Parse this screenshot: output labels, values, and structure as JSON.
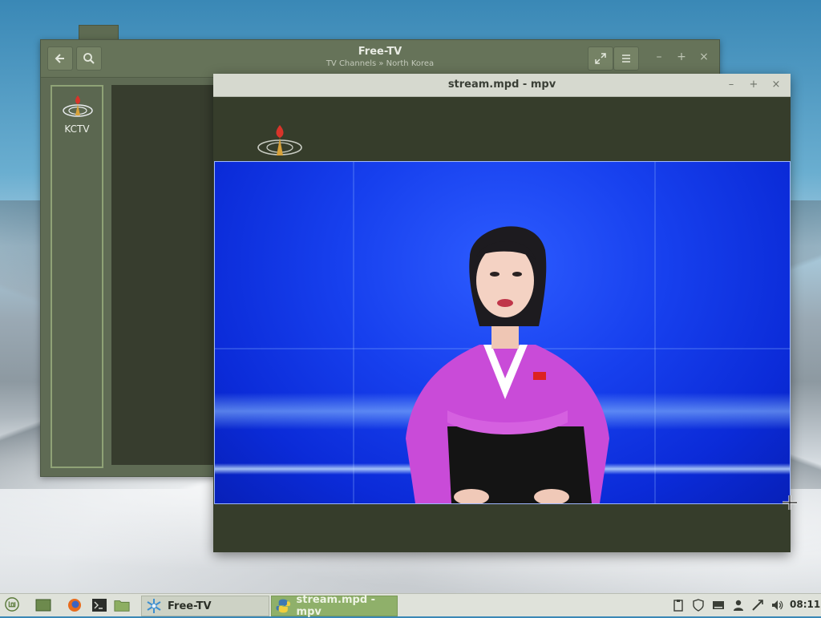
{
  "freetv_window": {
    "title": "Free-TV",
    "subtitle": "TV Channels » North Korea",
    "channels": [
      {
        "label": "KCTV"
      }
    ],
    "buttons": {
      "back": "back-icon",
      "search": "search-icon",
      "fullscreen": "fullscreen-icon",
      "menu": "hamburger-menu-icon"
    }
  },
  "mpv_window": {
    "title": "stream.mpd - mpv"
  },
  "taskbar": {
    "tasks": [
      {
        "label": "Free-TV",
        "icon": "snowflake-app-icon",
        "active": false
      },
      {
        "label": "stream.mpd - mpv",
        "icon": "python-icon",
        "active": true
      }
    ],
    "clock": "08:11"
  },
  "colors": {
    "window_bg": "#5f6b54",
    "mpv_bg": "#363d2b",
    "video_blue": "#1740ee",
    "active_task": "#8fb06a"
  }
}
